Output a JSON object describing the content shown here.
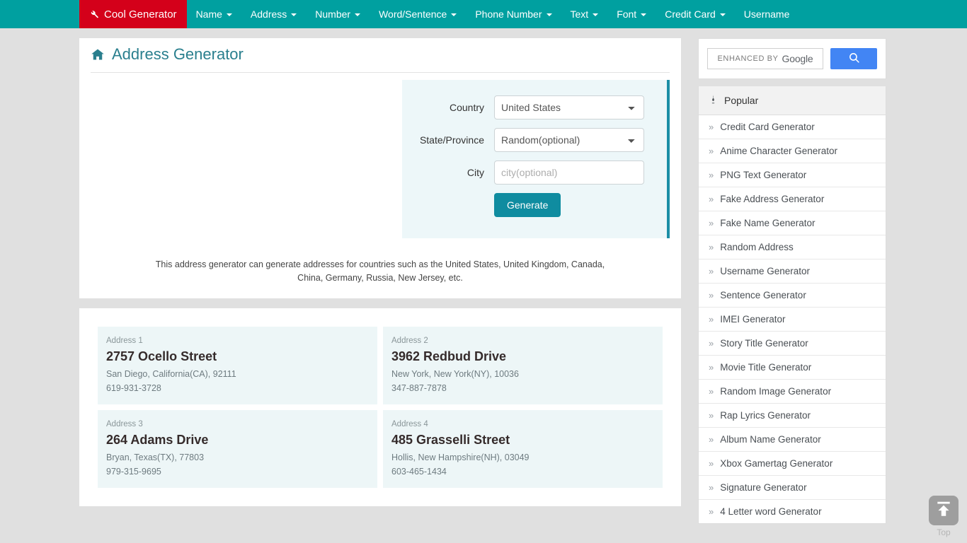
{
  "navbar": {
    "brand": {
      "label": "Cool Generator",
      "icon": "wrench-icon",
      "bg": "#d4001a"
    },
    "bg": "#00a0a0",
    "items": [
      {
        "label": "Name",
        "caret": true
      },
      {
        "label": "Address",
        "caret": true
      },
      {
        "label": "Number",
        "caret": true
      },
      {
        "label": "Word/Sentence",
        "caret": true
      },
      {
        "label": "Phone Number",
        "caret": true
      },
      {
        "label": "Text",
        "caret": true
      },
      {
        "label": "Font",
        "caret": true
      },
      {
        "label": "Credit Card",
        "caret": true
      },
      {
        "label": "Username",
        "caret": false
      }
    ]
  },
  "main": {
    "title": "Address Generator",
    "title_icon": "home-icon",
    "title_color": "#2a7f8e",
    "form": {
      "country_label": "Country",
      "country_value": "United States",
      "country_options": [
        "United States"
      ],
      "state_label": "State/Province",
      "state_value": "Random(optional)",
      "state_options": [
        "Random(optional)"
      ],
      "city_label": "City",
      "city_value": "",
      "city_placeholder": "city(optional)",
      "generate_label": "Generate",
      "generate_color": "#0f8ca0"
    },
    "description": "This address generator can generate addresses for countries such as the United States, United Kingdom, Canada, China, Germany, Russia, New Jersey, etc."
  },
  "results": [
    {
      "index": "Address 1",
      "street": "2757 Ocello Street",
      "locality": "San Diego, California(CA), 92111",
      "phone": "619-931-3728"
    },
    {
      "index": "Address 2",
      "street": "3962 Redbud Drive",
      "locality": "New York, New York(NY), 10036",
      "phone": "347-887-7878"
    },
    {
      "index": "Address 3",
      "street": "264 Adams Drive",
      "locality": "Bryan, Texas(TX), 77803",
      "phone": "979-315-9695"
    },
    {
      "index": "Address 4",
      "street": "485 Grasselli Street",
      "locality": "Hollis, New Hampshire(NH), 03049",
      "phone": "603-465-1434"
    }
  ],
  "sidebar": {
    "search": {
      "enhanced_label": "ENHANCED BY",
      "provider": "Google",
      "value": "",
      "button_icon": "search-icon",
      "button_color": "#4285f4"
    },
    "popular": {
      "heading": "Popular",
      "icon": "flame-icon",
      "items": [
        {
          "label": "Credit Card Generator"
        },
        {
          "label": "Anime Character Generator"
        },
        {
          "label": "PNG Text Generator"
        },
        {
          "label": "Fake Address Generator"
        },
        {
          "label": "Fake Name Generator"
        },
        {
          "label": "Random Address"
        },
        {
          "label": "Username Generator"
        },
        {
          "label": "Sentence Generator"
        },
        {
          "label": "IMEI Generator"
        },
        {
          "label": "Story Title Generator"
        },
        {
          "label": "Movie Title Generator"
        },
        {
          "label": "Random Image Generator"
        },
        {
          "label": "Rap Lyrics Generator"
        },
        {
          "label": "Album Name Generator"
        },
        {
          "label": "Xbox Gamertag Generator"
        },
        {
          "label": "Signature Generator"
        },
        {
          "label": "4 Letter word Generator"
        }
      ],
      "bullet": "»"
    }
  },
  "scroll_top": {
    "label": "Top",
    "icon": "arrow-up-to-line-icon"
  }
}
